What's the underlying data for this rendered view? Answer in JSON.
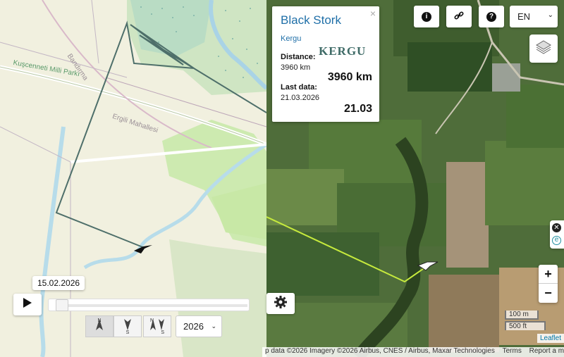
{
  "left_map": {
    "labels": {
      "park": "Kuşcenneti Milli Parkı",
      "road": "Bandırma",
      "district": "Ergili Mahallesi"
    }
  },
  "popup": {
    "species": "Black Stork",
    "project": "Kergu",
    "logo_text": "KERGU",
    "distance_label": "Distance:",
    "distance_small": "3960 km",
    "distance_big": "3960 km",
    "lastdata_label": "Last data:",
    "lastdata_small": "21.03.2026",
    "lastdata_big": "21.03",
    "close": "×"
  },
  "toolbar": {
    "info": "i",
    "link": "🔗",
    "help": "?",
    "language": "EN"
  },
  "zoom": {
    "in": "+",
    "out": "−"
  },
  "scale": {
    "metric": "100 m",
    "imperial": "500 ft"
  },
  "attribution": {
    "text": "p data ©2026 Imagery ©2026 Airbus, CNES / Airbus, Maxar Technologies",
    "terms": "Terms",
    "report": "Report a map error",
    "leaflet": "Leaflet"
  },
  "timeline": {
    "date": "15.02.2026",
    "year": "2026",
    "position": 0.0,
    "dir_buttons": [
      {
        "top": "N",
        "bottom": ""
      },
      {
        "top": "",
        "bottom": "S"
      },
      {
        "top": "N",
        "bottom": "S"
      }
    ]
  },
  "colors": {
    "track_left": "#4e6f6a",
    "track_right": "#c6ea3d",
    "popup_title": "#1f6fa8"
  }
}
